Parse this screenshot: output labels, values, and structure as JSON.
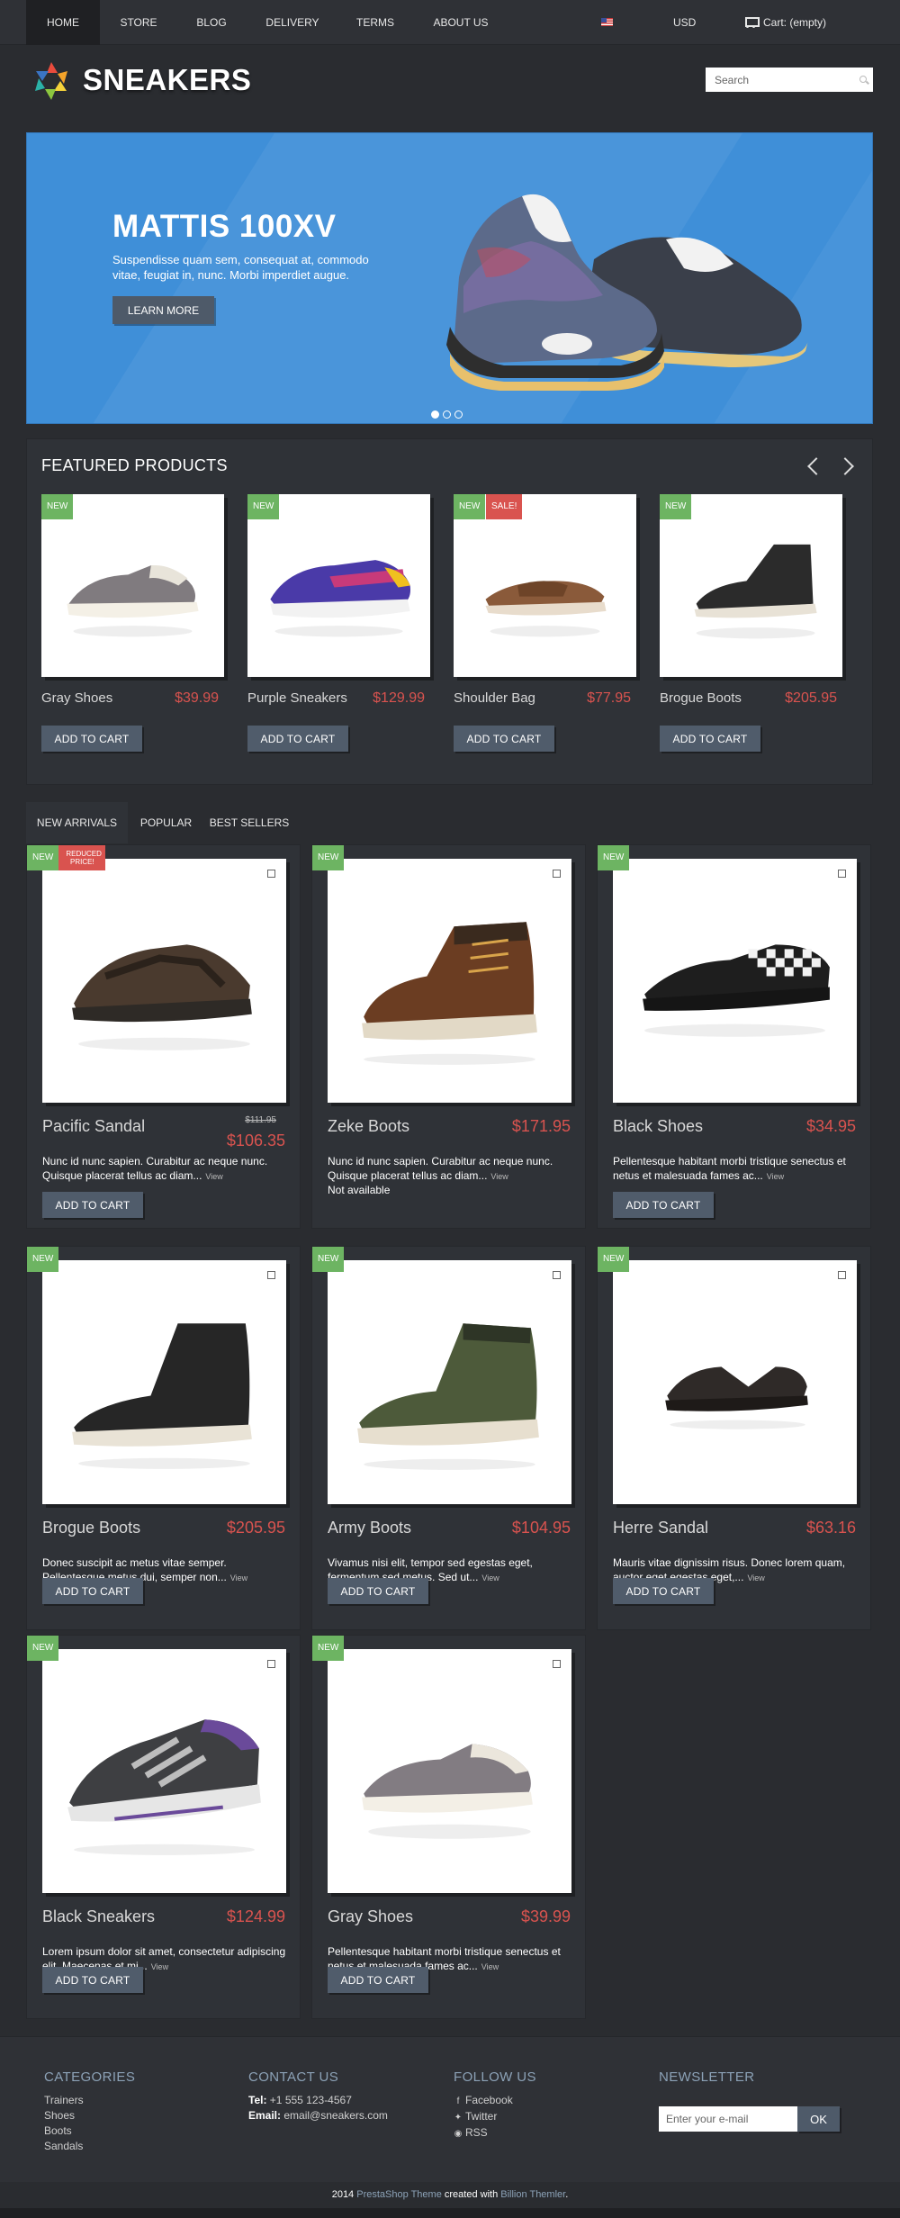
{
  "nav": {
    "items": [
      "HOME",
      "STORE",
      "BLOG",
      "DELIVERY",
      "TERMS",
      "ABOUT US"
    ],
    "currency": "USD",
    "cart": "Cart: (empty)"
  },
  "header": {
    "logo_text": "SNEAKERS",
    "search_placeholder": "Search"
  },
  "hero": {
    "title": "MATTIS 100XV",
    "text": "Suspendisse quam sem, consequat at, commodo vitae, feugiat in, nunc. Morbi imperdiet augue.",
    "button": "LEARN MORE"
  },
  "featured": {
    "title": "FEATURED PRODUCTS",
    "products": [
      {
        "name": "Gray Shoes",
        "price": "$39.99",
        "badges": [
          "NEW"
        ],
        "button": "ADD TO CART"
      },
      {
        "name": "Purple Sneakers",
        "price": "$129.99",
        "badges": [
          "NEW"
        ],
        "button": "ADD TO CART"
      },
      {
        "name": "Shoulder Bag",
        "price": "$77.95",
        "badges": [
          "NEW",
          "SALE!"
        ],
        "button": "ADD TO CART"
      },
      {
        "name": "Brogue Boots",
        "price": "$205.95",
        "badges": [
          "NEW"
        ],
        "button": "ADD TO CART"
      }
    ]
  },
  "tabs": [
    "NEW ARRIVALS",
    "POPULAR",
    "BEST SELLERS"
  ],
  "products": [
    {
      "name": "Pacific Sandal",
      "price": "$106.35",
      "old_price": "$111.95",
      "badges": [
        "NEW",
        "REDUCED PRICE!"
      ],
      "desc": "Nunc id nunc sapien. Curabitur ac neque nunc. Quisque placerat tellus ac diam...",
      "view": "View",
      "button": "ADD TO CART"
    },
    {
      "name": "Zeke Boots",
      "price": "$171.95",
      "badges": [
        "NEW"
      ],
      "desc": "Nunc id nunc sapien. Curabitur ac neque nunc. Quisque placerat tellus ac diam...",
      "view": "View",
      "availability": "Not available"
    },
    {
      "name": "Black Shoes",
      "price": "$34.95",
      "badges": [
        "NEW"
      ],
      "desc": "Pellentesque habitant morbi tristique senectus et netus et malesuada fames ac...",
      "view": "View",
      "button": "ADD TO CART"
    },
    {
      "name": "Brogue Boots",
      "price": "$205.95",
      "badges": [
        "NEW"
      ],
      "desc": "Donec suscipit ac metus vitae semper. Pellentesque metus dui, semper non...",
      "view": "View",
      "button": "ADD TO CART"
    },
    {
      "name": "Army Boots",
      "price": "$104.95",
      "badges": [
        "NEW"
      ],
      "desc": "Vivamus nisi elit, tempor sed egestas eget, fermentum sed metus. Sed ut...",
      "view": "View",
      "button": "ADD TO CART"
    },
    {
      "name": "Herre Sandal",
      "price": "$63.16",
      "badges": [
        "NEW"
      ],
      "desc": "Mauris vitae dignissim risus. Donec lorem quam, auctor eget egestas eget,...",
      "view": "View",
      "button": "ADD TO CART"
    },
    {
      "name": "Black Sneakers",
      "price": "$124.99",
      "badges": [
        "NEW"
      ],
      "desc": "Lorem ipsum dolor sit amet, consectetur adipiscing elit. Maecenas et mi...",
      "view": "View",
      "button": "ADD TO CART"
    },
    {
      "name": "Gray Shoes",
      "price": "$39.99",
      "badges": [
        "NEW"
      ],
      "desc": "Pellentesque habitant morbi tristique senectus et netus et malesuada fames ac...",
      "view": "View",
      "button": "ADD TO CART"
    }
  ],
  "footer": {
    "categories": {
      "title": "CATEGORIES",
      "items": [
        "Trainers",
        "Shoes",
        "Boots",
        "Sandals"
      ]
    },
    "contact": {
      "title": "CONTACT US",
      "tel_label": "Tel:",
      "tel": "+1 555 123-4567",
      "email_label": "Email:",
      "email": "email@sneakers.com"
    },
    "follow": {
      "title": "FOLLOW US",
      "items": [
        "Facebook",
        "Twitter",
        "RSS"
      ]
    },
    "newsletter": {
      "title": "NEWSLETTER",
      "placeholder": "Enter your e-mail",
      "button": "OK"
    }
  },
  "copyright": {
    "year": "2014",
    "theme": "PrestaShop Theme",
    "middle": "created with",
    "author": "Billion Themler",
    "end": "."
  },
  "colors": {
    "accent_price": "#d9534f",
    "badge_new": "#6db462",
    "hero_blue": "#3f8fd8",
    "button": "#505c6b"
  }
}
